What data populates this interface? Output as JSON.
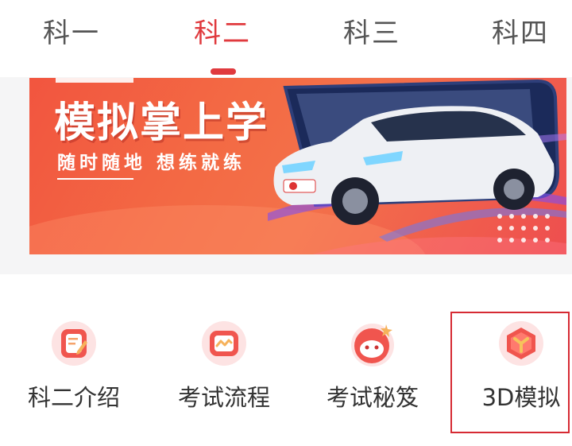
{
  "tabs": [
    {
      "label": "科一",
      "active": false
    },
    {
      "label": "科二",
      "active": true
    },
    {
      "label": "科三",
      "active": false
    },
    {
      "label": "科四",
      "active": false
    }
  ],
  "banner": {
    "title": "模拟掌上学",
    "subtitle": "随时随地 想练就练"
  },
  "shortcuts": [
    {
      "label": "科二介绍",
      "icon": "edit-document-icon"
    },
    {
      "label": "考试流程",
      "icon": "flow-chart-icon"
    },
    {
      "label": "考试秘笈",
      "icon": "monkey-face-icon"
    },
    {
      "label": "3D模拟",
      "icon": "3d-cube-icon"
    }
  ],
  "colors": {
    "accent": "#e03a3e",
    "text": "#333333",
    "tab_inactive": "#555555"
  }
}
